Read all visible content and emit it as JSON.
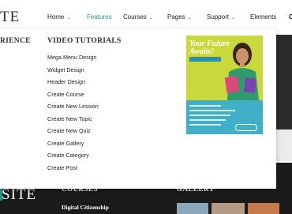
{
  "logo": {
    "text": "SITE",
    "top_visible": "TE"
  },
  "nav": {
    "items": [
      {
        "label": "Home",
        "has_dropdown": true
      },
      {
        "label": "Features",
        "has_dropdown": false,
        "active": true
      },
      {
        "label": "Courses",
        "has_dropdown": true
      },
      {
        "label": "Pages",
        "has_dropdown": true
      },
      {
        "label": "Support",
        "has_dropdown": true
      },
      {
        "label": "Elements",
        "has_dropdown": false
      }
    ],
    "cut_label": "C",
    "chevron_icon": "chevron-down-icon",
    "active_color": "#2f8f8a"
  },
  "mega_menu": {
    "left_heading_visible": "RIENCE",
    "video_heading": "VIDEO TUTORIALS",
    "video_items": [
      "Mega Menu Design",
      "Widget Design",
      "Header Design",
      "Create Course",
      "Create New Lession",
      "Create New Topic",
      "Create New Quiz",
      "Create Gallery",
      "Create Category",
      "Create Post"
    ],
    "promo": {
      "title_line1": "Your Future",
      "title_line2": "Awaits!"
    }
  },
  "footer": {
    "logo_text": "SITE",
    "courses_heading": "COURSES",
    "gallery_heading": "GALLERY",
    "course_link": "Digital Citizenship"
  }
}
